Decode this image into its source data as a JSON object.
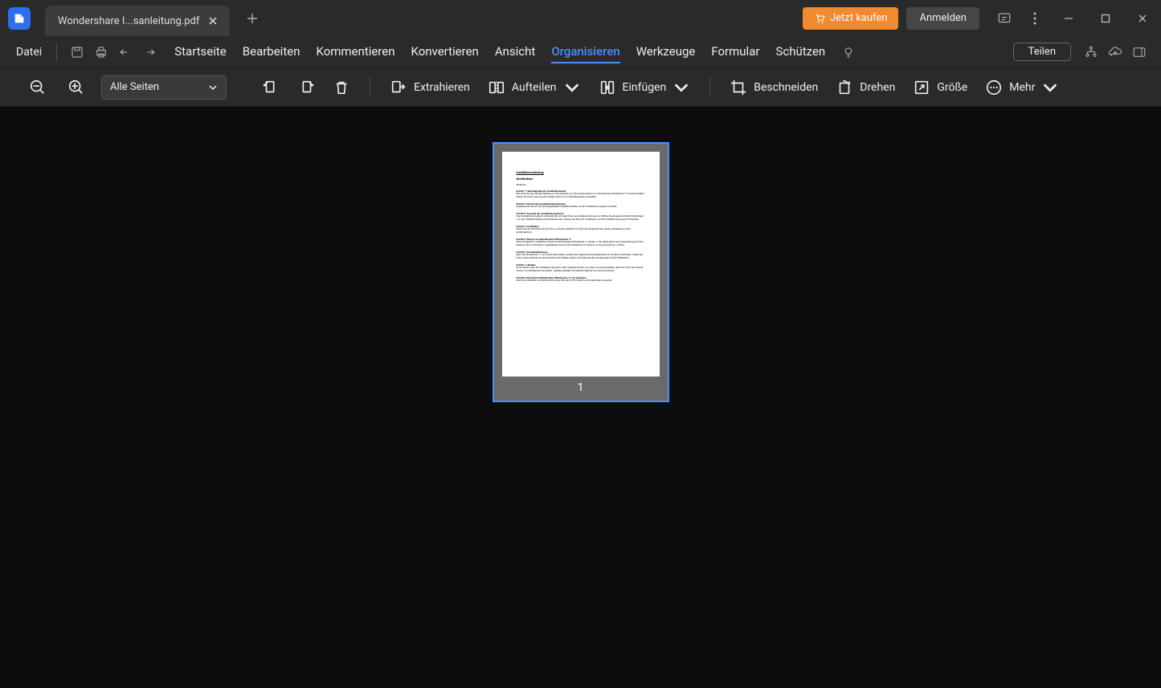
{
  "titlebar": {
    "tab_title": "Wondershare  I...sanleitung.pdf",
    "buy": "Jetzt kaufen",
    "login": "Anmelden"
  },
  "menubar": {
    "file": "Datei",
    "tabs": [
      "Startseite",
      "Bearbeiten",
      "Kommentieren",
      "Konvertieren",
      "Ansicht",
      "Organisieren",
      "Werkzeuge",
      "Formular",
      "Schützen"
    ],
    "active_index": 5,
    "share": "Teilen"
  },
  "toolbar": {
    "page_select": "Alle Seiten",
    "extract": "Extrahieren",
    "split": "Aufteilen",
    "insert": "Einfügen",
    "crop": "Beschneiden",
    "rotate": "Drehen",
    "size": "Größe",
    "more": "Mehr"
  },
  "page": {
    "number": "1",
    "doc_title": "Installationsanleitung",
    "doc_brand": "Wondershare",
    "doc_sub": "Windows",
    "s1_h": "Schritt 1: Herunterladen der Installationsdatei",
    "s1_t": "Besuchen Sie die offizielle Website von Wondershare, um die korrekte Version von Wondershare PDFelement 11 herunterzuladen. Stellen Sie sicher, dass Sie die richtige Version für Ihr Betriebssystem auswählen.",
    "s2_h": "Schritt 2: Starten des Installationsprogramms",
    "s2_t": "Doppelklicken Sie auf die heruntergeladene Installationsdatei, um den Installationsvorgang zu starten.",
    "s3_h": "Schritt 3: Auswahl der Installationsoptionen",
    "s3_t": "Das Installationsprogramm wird gestartet und zeigt Ihnen verschiedene Optionen an. Wählen Sie die gewünschten Einstellungen, z. B. den Installationspfad und die Sprache aus. Klicken Sie dann auf 'Installieren', um den Installationsprozess fortzusetzen.",
    "s4_h": "Schritt 4: Installation",
    "s4_t": "Warten Sie, bis die Software auf Ihrem Computer installiert ist. Dies kann einige Minuten dauern, abhängig von Ihrer Systemleistung.",
    "s5_h": "Schritt 5: Starten von Wondershare PDFelement 11",
    "s5_t": "Nach erfolgreicher Installation können Sie Wondershare PDFelement 11 starten. In der Regel gibt es eine Verknüpfung auf Ihrem Desktop oder im Startmenü. Doppelklicken Sie auf das PDFelement 11-Symbol, um die Anwendung zu öffnen.",
    "s6_h": "Schritt 6: Produktaktivierung",
    "s6_t": "Wenn Sie PDFelement 11 zum ersten Mal starten, werden Sie möglicherweise aufgefordert, Ihr Produkt zu aktivieren. Geben Sie Ihren Lizenzschlüssel ein, den Sie beim Kauf erhalten haben, und folgen Sie den Anweisungen auf dem Bildschirm.",
    "s7_h": "Schritt 7: Updates",
    "s7_t": "Es ist ratsam, nach der Installation die Option 'Nach Updates suchen' zu nutzen, um sicherzustellen, dass Sie immer die neueste Version von PDFelement verwenden. Updates enthalten oft Fehlerkorrekturen und neue Funktionen.",
    "s8_h": "Schritt 8: Sie können Wondershare PDFelement 11 nun benutzen",
    "s8_t": "Nach der Installation und Aktivierung können Sie sofort Ihr Produkt von Wondershare verwenden."
  }
}
